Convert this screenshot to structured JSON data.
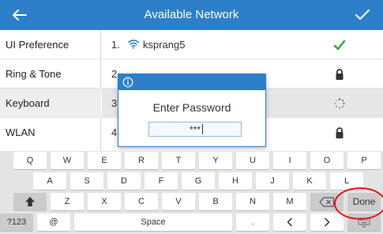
{
  "header": {
    "title": "Available Network",
    "background": "#2d7fc9",
    "back_icon": "arrow-left-icon",
    "confirm_icon": "checkmark-icon"
  },
  "sidebar": {
    "items": [
      {
        "label": "UI Preference",
        "active": false
      },
      {
        "label": "Ring & Tone",
        "active": false
      },
      {
        "label": "Keyboard",
        "active": true
      },
      {
        "label": "WLAN",
        "active": false
      }
    ]
  },
  "networks": [
    {
      "index": "1.",
      "name": "ksprang5",
      "wifi_icon": "wifi-icon",
      "status": "connected",
      "status_icon": "green-checkmark-icon",
      "status_color": "#3aa13a"
    },
    {
      "index": "2.",
      "name": "",
      "status": "locked",
      "status_icon": "lock-icon"
    },
    {
      "index": "3.",
      "name": "",
      "status": "connecting",
      "status_icon": "spinner-icon",
      "selected": true
    },
    {
      "index": "4.",
      "name": "",
      "status": "locked",
      "status_icon": "lock-icon"
    }
  ],
  "dialog": {
    "info_icon": "info-icon",
    "title": "Enter Password",
    "password_value": "***"
  },
  "keyboard": {
    "row1": [
      "Q",
      "W",
      "E",
      "R",
      "T",
      "Y",
      "U",
      "I",
      "O",
      "P"
    ],
    "row2": [
      "A",
      "S",
      "D",
      "F",
      "G",
      "H",
      "J",
      "K",
      "L"
    ],
    "row3_shift_icon": "shift-up-arrow-icon",
    "row3": [
      "Z",
      "X",
      "C",
      "V",
      "B",
      "N",
      "M"
    ],
    "backspace_icon": "backspace-icon",
    "done_label": "Done",
    "row4": {
      "symbols_label": "?123",
      "at_label": "@",
      "space_label": "Space",
      "period_label": ".",
      "left_icon": "chevron-left-icon",
      "right_icon": "chevron-right-icon",
      "hide_keyboard_icon": "keyboard-icon"
    },
    "highlight_color": "#e0141c"
  }
}
